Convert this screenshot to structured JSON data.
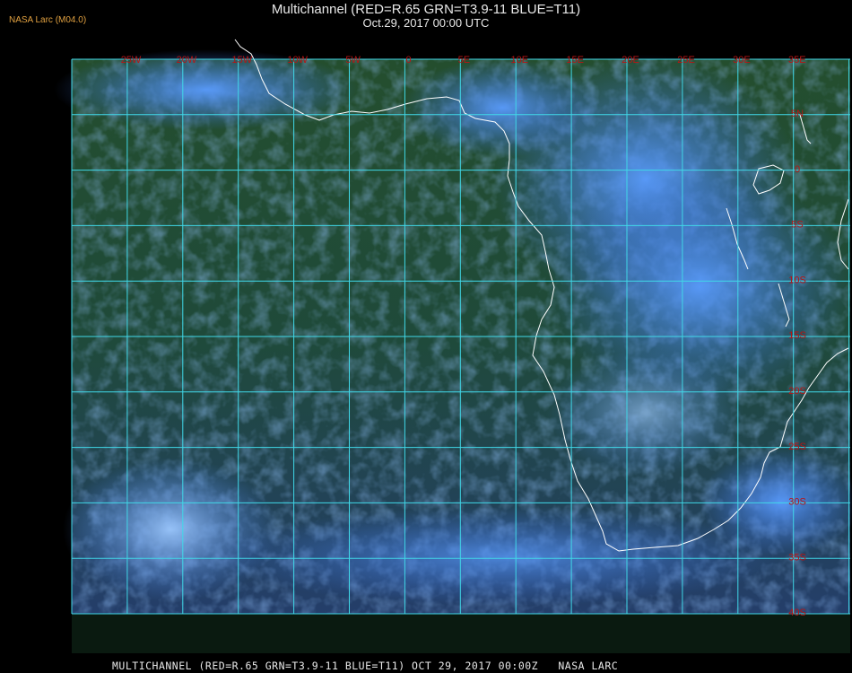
{
  "header": {
    "credit": "NASA Larc (M04.0)",
    "title": "Multichannel (RED=R.65 GRN=T3.9-11 BLUE=T11)",
    "subtitle": "Oct.29, 2017 00:00 UTC"
  },
  "footer": {
    "text": "MULTICHANNEL (RED=R.65 GRN=T3.9-11 BLUE=T11) OCT 29, 2017 00:00Z   NASA LARC"
  },
  "map": {
    "longitude_labels": [
      "25W",
      "20W",
      "15W",
      "10W",
      "5W",
      "0",
      "5E",
      "10E",
      "15E",
      "20E",
      "25E",
      "30E",
      "35E"
    ],
    "latitude_labels": [
      "5N",
      "0",
      "5S",
      "10S",
      "15S",
      "20S",
      "25S",
      "30S",
      "35S",
      "40S"
    ],
    "colors": {
      "grid": "#40d8e8",
      "coast": "#ffffff",
      "label": "#b81414",
      "ocean": "#1c4a2a",
      "cloud": "#3a7cf0"
    }
  }
}
